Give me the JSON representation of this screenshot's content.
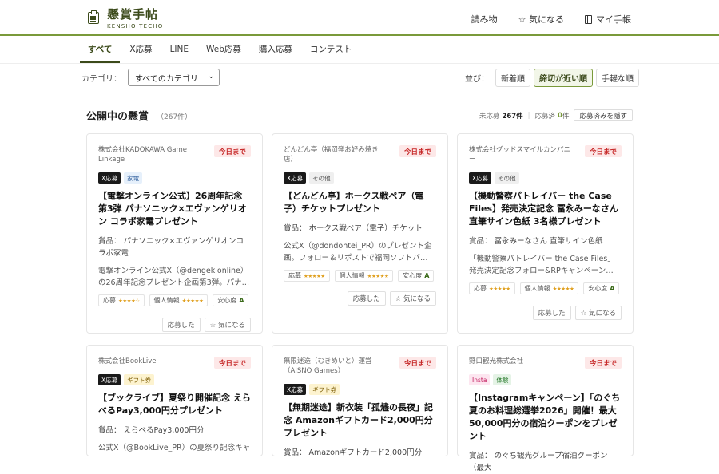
{
  "header": {
    "logo_title": "懸賞手帖",
    "logo_sub": "KENSHO TECHO",
    "nav": {
      "read": "読み物",
      "fav": "☆ 気になる",
      "mypage": "マイ手帳"
    }
  },
  "tabs": [
    "すべて",
    "X応募",
    "LINE",
    "Web応募",
    "購入応募",
    "コンテスト"
  ],
  "filter": {
    "category_label": "カテゴリ：",
    "category_value": "すべてのカテゴリ"
  },
  "sort": {
    "label": "並び：",
    "options": [
      "新着順",
      "締切が近い順",
      "手軽な順"
    ]
  },
  "section": {
    "title": "公開中の懸賞",
    "count": "（267件）",
    "unapplied_label": "未応募",
    "unapplied_value": "267件",
    "applied_label": "応募済",
    "applied_value": "0",
    "applied_unit": "件",
    "hide_button": "応募済みを隠す"
  },
  "labels": {
    "today": "今日まで",
    "apply_rating": "応募",
    "privacy_rating": "個人情報",
    "safety_rating": "安心度",
    "applied_btn": "応募した",
    "fav_btn": "☆ 気になる"
  },
  "cards": [
    {
      "company": "株式会社KADOKAWA Game Linkage",
      "tags": [
        "X応募",
        "家電"
      ],
      "title": "【電撃オンライン公式】26周年記念第3弾 パナソニック×エヴァンゲリオン コラボ家電プレゼント",
      "prize": "賞品： パナソニック×エヴァンゲリオンコラボ家電",
      "desc": "電撃オンライン公式X（@dengekionline）の26周年記念プレゼント企画第3弾。パナ…",
      "apply_stars": "★★★★☆",
      "privacy_stars": "★★★★★",
      "safety": "A"
    },
    {
      "company": "どんどん亭（福岡発お好み焼き店）",
      "tags": [
        "X応募",
        "その他"
      ],
      "title": "【どんどん亭】ホークス戦ペア（電子）チケットプレゼント",
      "prize": "賞品： ホークス戦ペア（電子）チケット",
      "desc": "公式X（@dondontei_PR）のプレゼント企画。フォロー＆リポストで福岡ソフトバ…",
      "apply_stars": "★★★★★",
      "privacy_stars": "★★★★★",
      "safety": "A"
    },
    {
      "company": "株式会社グッドスマイルカンパニー",
      "tags": [
        "X応募",
        "その他"
      ],
      "title": "【機動警察パトレイバー the Case Files】発売決定記念 冨永みーなさん直筆サイン色紙 3名様プレゼント",
      "prize": "賞品： 冨永みーなさん 直筆サイン色紙",
      "desc": "「機動警察パトレイバー the Case Files」発売決定記念フォロー&RPキャンペーン…",
      "apply_stars": "★★★★★",
      "privacy_stars": "★★★★★",
      "safety": "A"
    },
    {
      "company": "株式会社BookLive",
      "tags": [
        "X応募",
        "ギフト券"
      ],
      "title": "【ブックライブ】夏祭り開催記念 えらべるPay3,000円分プレゼント",
      "prize": "賞品： えらべるPay3,000円分",
      "desc": "公式X（@BookLive_PR）の夏祭り記念キャ"
    },
    {
      "company": "無限迷迭（むきめいと）運営（AISNO Games）",
      "tags": [
        "X応募",
        "ギフト券"
      ],
      "title": "【無期迷途】新衣装「孤燼の長夜」記念 Amazonギフトカード2,000円分プレゼント",
      "prize": "賞品： Amazonギフトカード2,000円分"
    },
    {
      "company": "野口観光株式会社",
      "tags": [
        "Insta",
        "体験"
      ],
      "title": "【Instagramキャンペーン】「のぐち夏のお料理総選挙2026」開催！最大50,000円分の宿泊クーポンをプレゼント",
      "prize": "賞品： のぐち観光グループ宿泊クーポン（最大"
    }
  ]
}
